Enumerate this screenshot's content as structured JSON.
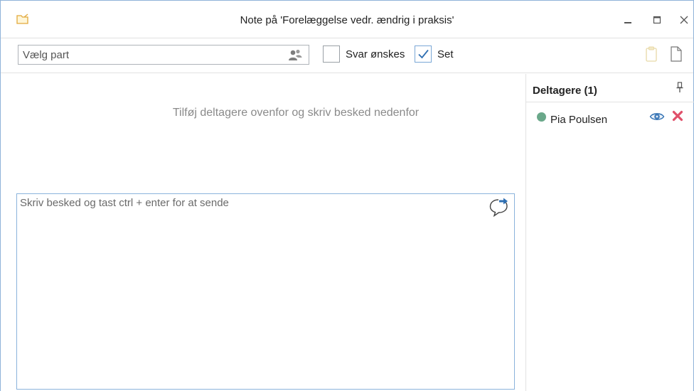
{
  "window": {
    "title": "Note på 'Forelæggelse vedr. ændrig i praksis'",
    "icon": "note-folder-icon"
  },
  "toolbar": {
    "party_placeholder": "Vælg part",
    "svar_label": "Svar ønskes",
    "svar_checked": false,
    "set_label": "Set",
    "set_checked": true
  },
  "main": {
    "hint": "Tilføj deltagere ovenfor og skriv besked nedenfor",
    "message_placeholder": "Skriv besked og tast ctrl + enter for at sende"
  },
  "participants": {
    "title": "Deltagere (1)",
    "items": [
      {
        "name": "Pia Poulsen",
        "status_color": "#6aa88a"
      }
    ]
  },
  "colors": {
    "accent": "#2f6fb2",
    "remove": "#e0506a",
    "window_border": "#8fb3d9"
  }
}
